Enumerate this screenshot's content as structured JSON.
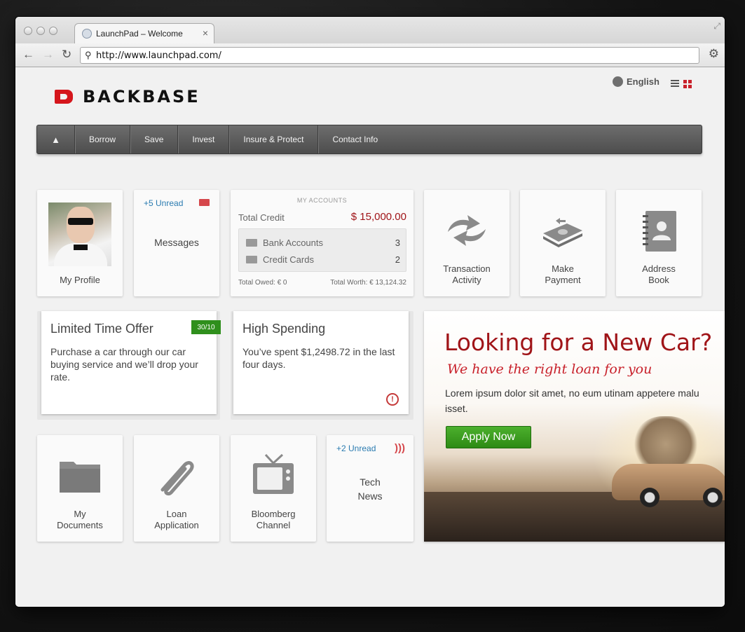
{
  "browser": {
    "tab_title": "LaunchPad – Welcome",
    "tab_close": "×",
    "url": "http://www.launchpad.com/",
    "back_glyph": "←",
    "forward_glyph": "→",
    "reload_glyph": "↻",
    "wrench_glyph": "🔧"
  },
  "header": {
    "logo_text": "BACKBASE",
    "language": "English",
    "brand_color": "#d5161c"
  },
  "nav": {
    "home_glyph": "▲",
    "items": [
      "Borrow",
      "Save",
      "Invest",
      "Insure & Protect",
      "Contact Info"
    ]
  },
  "widgets": {
    "profile": {
      "label": "My Profile"
    },
    "messages": {
      "unread": "+5 Unread",
      "label": "Messages"
    },
    "accounts": {
      "heading": "MY ACCOUNTS",
      "total_credit_label": "Total Credit",
      "total_credit_value": "$ 15,000.00",
      "rows": [
        {
          "label": "Bank Accounts",
          "count": "3"
        },
        {
          "label": "Credit Cards",
          "count": "2"
        }
      ],
      "total_owed": "Total Owed: € 0",
      "total_worth": "Total Worth: € 13,124.32"
    },
    "transaction": {
      "line1": "Transaction",
      "line2": "Activity"
    },
    "payment": {
      "line1": "Make",
      "line2": "Payment"
    },
    "address": {
      "line1": "Address",
      "line2": "Book"
    },
    "offer": {
      "title": "Limited Time Offer",
      "ribbon": "30/10",
      "body": "Purchase a car through our car buying service and we’ll drop your rate."
    },
    "spending": {
      "title": "High Spending",
      "body": "You’ve spent $1,2498.72 in the last four days.",
      "alert_glyph": "!"
    },
    "documents": {
      "line1": "My",
      "line2": "Documents"
    },
    "loan": {
      "line1": "Loan",
      "line2": "Application"
    },
    "bloomberg": {
      "line1": "Bloomberg",
      "line2": "Channel"
    },
    "technews": {
      "unread": "+2 Unread",
      "line1": "Tech",
      "line2": "News"
    }
  },
  "banner": {
    "title": "Looking for a New Car?",
    "subtitle": "We have the right loan for you",
    "body": "Lorem ipsum dolor sit amet, no eum utinam appetere malu isset.",
    "button": "Apply Now",
    "title_color": "#a01418",
    "button_color": "#3a9d1f"
  }
}
